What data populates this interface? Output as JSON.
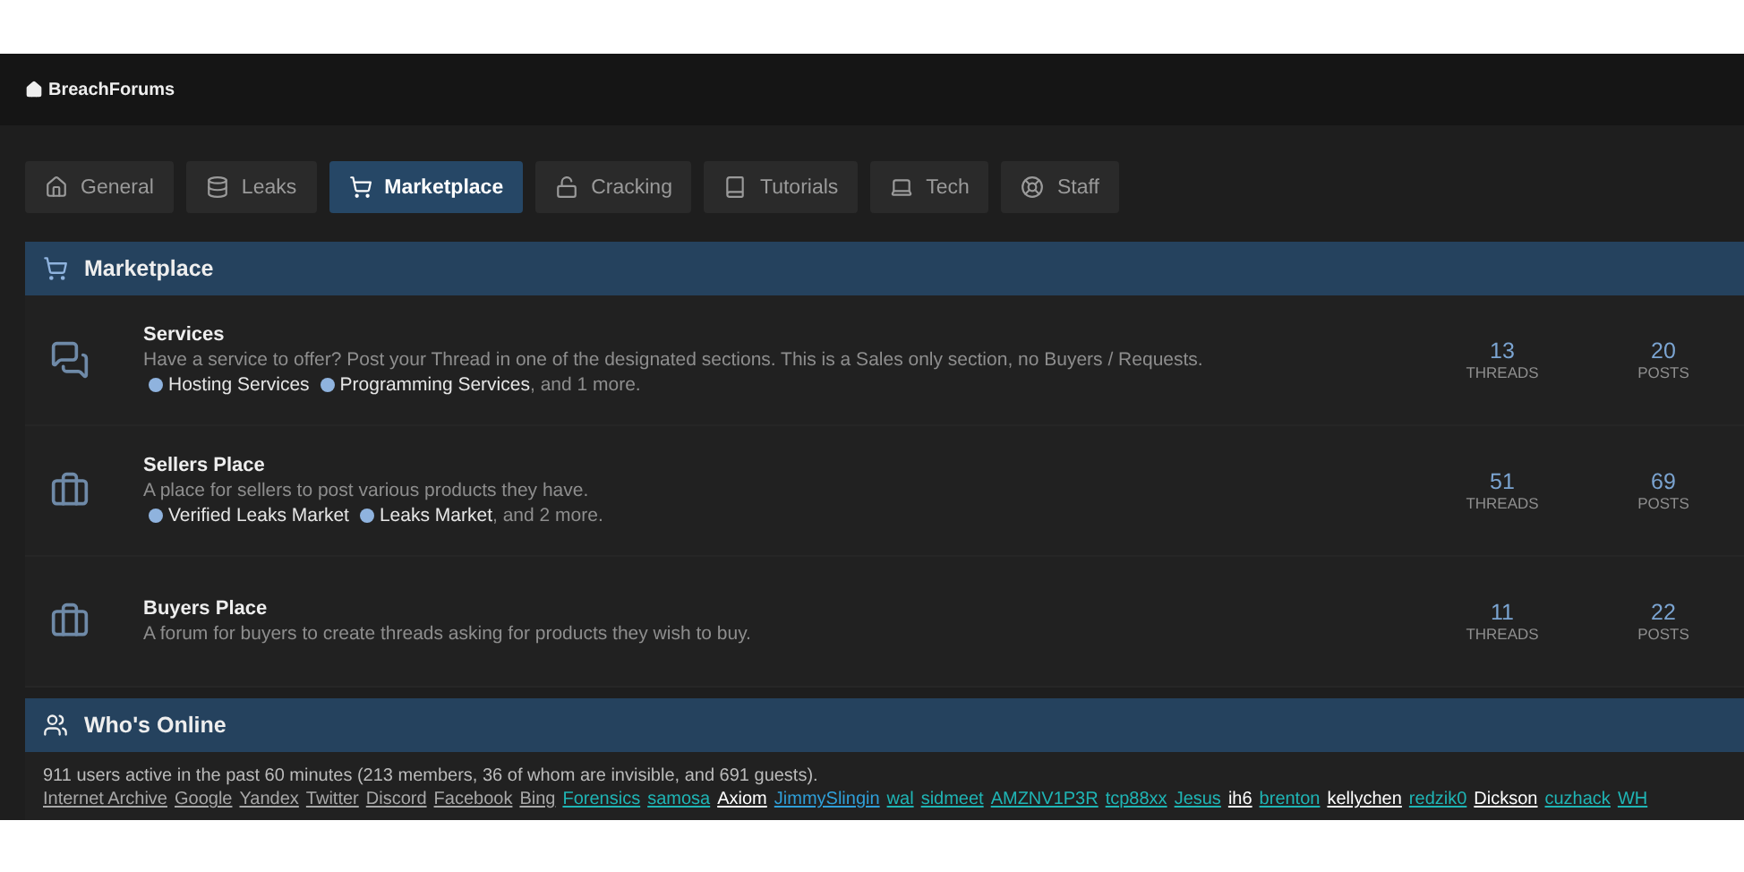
{
  "site": {
    "title": "BreachForums"
  },
  "tabs": [
    {
      "label": "General",
      "selected": false
    },
    {
      "label": "Leaks",
      "selected": false
    },
    {
      "label": "Marketplace",
      "selected": true
    },
    {
      "label": "Cracking",
      "selected": false
    },
    {
      "label": "Tutorials",
      "selected": false
    },
    {
      "label": "Tech",
      "selected": false
    },
    {
      "label": "Staff",
      "selected": false
    }
  ],
  "category": {
    "title": "Marketplace",
    "forums": [
      {
        "name": "Services",
        "description": "Have a service to offer? Post your Thread in one of the designated sections. This is a Sales only section, no Buyers / Requests.",
        "subforums": [
          "Hosting Services",
          "Programming Services"
        ],
        "more": ", and 1 more.",
        "threads": "13",
        "threads_label": "THREADS",
        "posts": "20",
        "posts_label": "POSTS"
      },
      {
        "name": "Sellers Place",
        "description": "A place for sellers to post various products they have.",
        "subforums": [
          "Verified Leaks Market",
          "Leaks Market"
        ],
        "more": ", and 2 more.",
        "threads": "51",
        "threads_label": "THREADS",
        "posts": "69",
        "posts_label": "POSTS"
      },
      {
        "name": "Buyers Place",
        "description": "A forum for buyers to create threads asking for products they wish to buy.",
        "threads": "11",
        "threads_label": "THREADS",
        "posts": "22",
        "posts_label": "POSTS"
      }
    ]
  },
  "whos_online": {
    "title": "Who's Online",
    "summary": "911 users active in the past 60 minutes (213 members, 36 of whom are invisible, and 691 guests).",
    "users": [
      {
        "name": "Internet Archive",
        "color": "#a8a8a8"
      },
      {
        "name": "Google",
        "color": "#a8a8a8"
      },
      {
        "name": "Yandex",
        "color": "#a8a8a8"
      },
      {
        "name": "Twitter",
        "color": "#a8a8a8"
      },
      {
        "name": "Discord",
        "color": "#a8a8a8"
      },
      {
        "name": "Facebook",
        "color": "#a8a8a8"
      },
      {
        "name": "Bing",
        "color": "#a8a8a8"
      },
      {
        "name": "Forensics",
        "color": "#1fb5b5"
      },
      {
        "name": "samosa",
        "color": "#1fb5b5"
      },
      {
        "name": "Axiom",
        "color": "#ffffff"
      },
      {
        "name": "JimmySlingin",
        "color": "#2f9fd8"
      },
      {
        "name": "wal",
        "color": "#1fb5b5"
      },
      {
        "name": "sidmeet",
        "color": "#1fb5b5"
      },
      {
        "name": "AMZNV1P3R",
        "color": "#1fb5b5"
      },
      {
        "name": "tcp88xx",
        "color": "#1fb5b5"
      },
      {
        "name": "Jesus",
        "color": "#1fb5b5"
      },
      {
        "name": "ih6",
        "color": "#ffffff"
      },
      {
        "name": "brenton",
        "color": "#1fb5b5"
      },
      {
        "name": "kellychen",
        "color": "#ffffff"
      },
      {
        "name": "redzik0",
        "color": "#1fb5b5"
      },
      {
        "name": "Dickson",
        "color": "#ffffff"
      },
      {
        "name": "cuzhack",
        "color": "#1fb5b5"
      },
      {
        "name": "WH",
        "color": "#1fb5b5"
      }
    ]
  }
}
